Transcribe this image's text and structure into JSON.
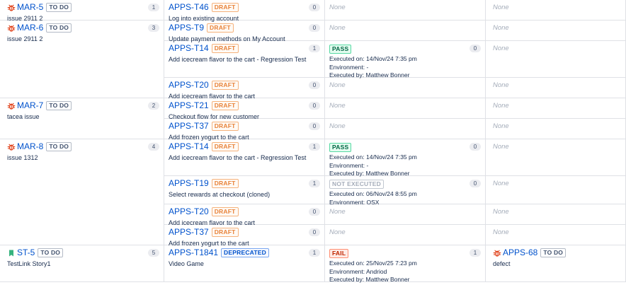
{
  "labels": {
    "none": "None",
    "executed_on": "Executed on:",
    "environment": "Environment:",
    "executed_by": "Executed by:"
  },
  "issues": [
    {
      "key": "MAR-5",
      "type": "bug",
      "status": "TO DO",
      "summary": "issue 2911 2",
      "test_count": "1",
      "tests": [
        {
          "key": "APPS-T46",
          "status": "DRAFT",
          "status_kind": "draft",
          "summary": "Log into existing account",
          "exec_count": "0",
          "execution": null,
          "defects": null
        }
      ]
    },
    {
      "key": "MAR-6",
      "type": "bug",
      "status": "TO DO",
      "summary": "issue 2911 2",
      "test_count": "3",
      "tests": [
        {
          "key": "APPS-T9",
          "status": "DRAFT",
          "status_kind": "draft",
          "summary": "Update payment methods on My Account",
          "exec_count": "0",
          "execution": null,
          "defects": null
        },
        {
          "key": "APPS-T14",
          "status": "DRAFT",
          "status_kind": "draft",
          "summary": "Add icecream flavor to the cart - Regression Test",
          "exec_count": "1",
          "execution": {
            "status": "PASS",
            "status_kind": "pass",
            "count": "0",
            "executed_on": "14/Nov/24 7:35 pm",
            "environment": "-",
            "executed_by": "Matthew Bonner"
          },
          "defects": null
        },
        {
          "key": "APPS-T20",
          "status": "DRAFT",
          "status_kind": "draft",
          "summary": "Add icecream flavor to the cart",
          "exec_count": "0",
          "execution": null,
          "defects": null
        }
      ]
    },
    {
      "key": "MAR-7",
      "type": "bug",
      "status": "TO DO",
      "summary": "tacea issue",
      "test_count": "2",
      "tests": [
        {
          "key": "APPS-T21",
          "status": "DRAFT",
          "status_kind": "draft",
          "summary": "Checkout flow for new customer",
          "exec_count": "0",
          "execution": null,
          "defects": null
        },
        {
          "key": "APPS-T37",
          "status": "DRAFT",
          "status_kind": "draft",
          "summary": "Add frozen yogurt to the cart",
          "exec_count": "0",
          "execution": null,
          "defects": null
        }
      ]
    },
    {
      "key": "MAR-8",
      "type": "bug",
      "status": "TO DO",
      "summary": "issue 1312",
      "test_count": "4",
      "tests": [
        {
          "key": "APPS-T14",
          "status": "DRAFT",
          "status_kind": "draft",
          "summary": "Add icecream flavor to the cart - Regression Test",
          "exec_count": "1",
          "execution": {
            "status": "PASS",
            "status_kind": "pass",
            "count": "0",
            "executed_on": "14/Nov/24 7:35 pm",
            "environment": "-",
            "executed_by": "Matthew Bonner"
          },
          "defects": null
        },
        {
          "key": "APPS-T19",
          "status": "DRAFT",
          "status_kind": "draft",
          "summary": "Select rewards at checkout (cloned)",
          "exec_count": "1",
          "execution": {
            "status": "NOT EXECUTED",
            "status_kind": "notexec",
            "count": "0",
            "executed_on": "06/Nov/24 8:55 pm",
            "environment": "OSX",
            "executed_by": null
          },
          "defects": null
        },
        {
          "key": "APPS-T20",
          "status": "DRAFT",
          "status_kind": "draft",
          "summary": "Add icecream flavor to the cart",
          "exec_count": "0",
          "execution": null,
          "defects": null
        },
        {
          "key": "APPS-T37",
          "status": "DRAFT",
          "status_kind": "draft",
          "summary": "Add frozen yogurt to the cart",
          "exec_count": "0",
          "execution": null,
          "defects": null
        }
      ]
    },
    {
      "key": "ST-5",
      "type": "story",
      "status": "TO DO",
      "summary": "TestLink Story1",
      "test_count": "5",
      "tests": [
        {
          "key": "APPS-T1841",
          "status": "DEPRECATED",
          "status_kind": "deprecated",
          "summary": "Video Game",
          "exec_count": "1",
          "execution": {
            "status": "FAIL",
            "status_kind": "fail",
            "count": "1",
            "executed_on": "25/Nov/25 7:23 pm",
            "environment": "Andriod",
            "executed_by": "Matthew Bonner"
          },
          "defects": {
            "key": "APPS-68",
            "type": "bug",
            "status": "TO DO",
            "summary": "defect"
          }
        }
      ]
    }
  ],
  "colors": {
    "bug": "#de350b",
    "story": "#36b37e",
    "link": "#0052cc",
    "border": "#dfe1e6"
  }
}
